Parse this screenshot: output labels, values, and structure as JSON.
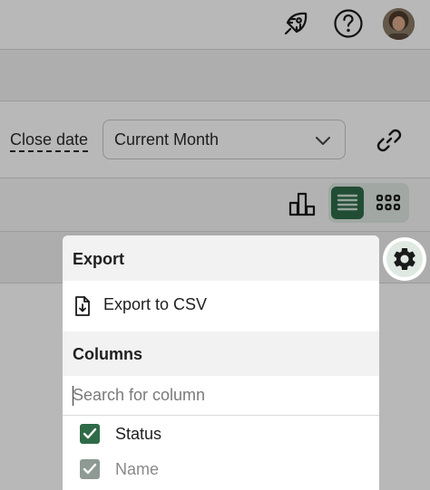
{
  "filters": {
    "close_date_label": "Close date",
    "period_value": "Current Month"
  },
  "icons": {
    "rocket": "rocket-icon",
    "help": "help-circle-icon",
    "link": "link-icon",
    "chart": "bar-chart-icon",
    "list": "list-view-icon",
    "grid": "grid-view-icon",
    "settings": "gear-icon",
    "export": "file-download-icon"
  },
  "menu": {
    "export_title": "Export",
    "export_csv_label": "Export to CSV",
    "columns_title": "Columns",
    "search_placeholder": "Search for column",
    "columns": [
      {
        "label": "Status",
        "checked": true
      },
      {
        "label": "Name",
        "checked": true
      }
    ]
  },
  "colors": {
    "accent": "#2f6b48",
    "accent_light": "#dfe9e2"
  }
}
